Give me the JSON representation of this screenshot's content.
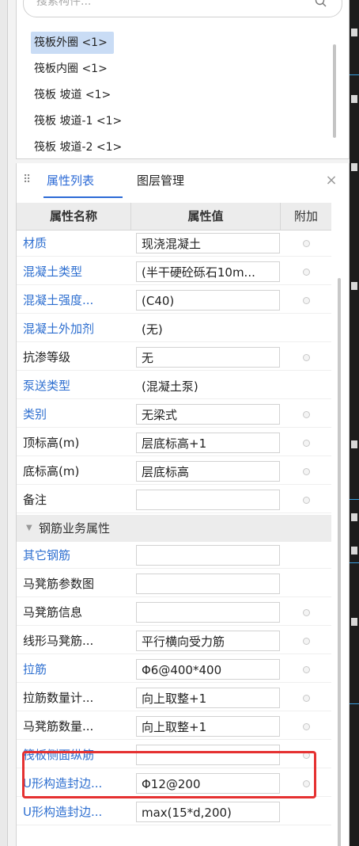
{
  "search": {
    "placeholder": "搜索构件..."
  },
  "component_list": [
    {
      "label": "筏板外圈 <1>",
      "selected": true
    },
    {
      "label": "筏板内圈 <1>",
      "selected": false
    },
    {
      "label": "筏板 坡道 <1>",
      "selected": false
    },
    {
      "label": "筏板 坡道-1 <1>",
      "selected": false
    },
    {
      "label": "筏板 坡道-2 <1>",
      "selected": false
    }
  ],
  "panel": {
    "tabs": [
      {
        "label": "属性列表",
        "active": true
      },
      {
        "label": "图层管理",
        "active": false
      }
    ],
    "close_icon": "×",
    "drag_icon": "⠿"
  },
  "table": {
    "headers": {
      "name": "属性名称",
      "value": "属性值",
      "extra": "附加"
    },
    "rows": [
      {
        "name": "材质",
        "value": "现浇混凝土",
        "blue": true,
        "boxed": true,
        "radio": true
      },
      {
        "name": "混凝土类型",
        "value": "(半干硬砼砾石10m...",
        "blue": true,
        "boxed": true,
        "radio": true
      },
      {
        "name": "混凝土强度...",
        "value": "(C40)",
        "blue": true,
        "boxed": true,
        "radio": true
      },
      {
        "name": "混凝土外加剂",
        "value": "(无)",
        "blue": true,
        "boxed": false,
        "radio": false
      },
      {
        "name": "抗渗等级",
        "value": "无",
        "blue": false,
        "boxed": true,
        "radio": true
      },
      {
        "name": "泵送类型",
        "value": "(混凝土泵)",
        "blue": true,
        "boxed": false,
        "radio": false
      },
      {
        "name": "类别",
        "value": "无梁式",
        "blue": true,
        "boxed": true,
        "radio": true
      },
      {
        "name": "顶标高(m)",
        "value": "层底标高+1",
        "blue": false,
        "boxed": true,
        "radio": true
      },
      {
        "name": "底标高(m)",
        "value": "层底标高",
        "blue": false,
        "boxed": true,
        "radio": true
      },
      {
        "name": "备注",
        "value": "",
        "blue": false,
        "boxed": true,
        "radio": true
      }
    ],
    "group": {
      "title": "钢筋业务属性",
      "arrow": "▼"
    },
    "group_rows": [
      {
        "name": "其它钢筋",
        "value": "",
        "blue": true,
        "boxed": true,
        "radio": false
      },
      {
        "name": "马凳筋参数图",
        "value": "",
        "blue": false,
        "boxed": true,
        "radio": false
      },
      {
        "name": "马凳筋信息",
        "value": "",
        "blue": false,
        "boxed": true,
        "radio": true
      },
      {
        "name": "线形马凳筋...",
        "value": "平行横向受力筋",
        "blue": false,
        "boxed": true,
        "radio": true
      },
      {
        "name": "拉筋",
        "value": "Φ6@400*400",
        "blue": true,
        "boxed": true,
        "radio": true
      },
      {
        "name": "拉筋数量计...",
        "value": "向上取整+1",
        "blue": false,
        "boxed": true,
        "radio": true
      },
      {
        "name": "马凳筋数量...",
        "value": "向上取整+1",
        "blue": false,
        "boxed": true,
        "radio": true
      },
      {
        "name": "筏板侧面纵筋",
        "value": "",
        "blue": true,
        "boxed": true,
        "radio": true
      },
      {
        "name": "U形构造封边...",
        "value": "Φ12@200",
        "blue": true,
        "boxed": true,
        "radio": true
      },
      {
        "name": "U形构造封边...",
        "value": "max(15*d,200)",
        "blue": true,
        "boxed": true,
        "radio": false
      }
    ]
  },
  "colors": {
    "accent": "#2b6ad6",
    "highlight": "#e53131",
    "selected_bg": "#c9dcf5"
  }
}
